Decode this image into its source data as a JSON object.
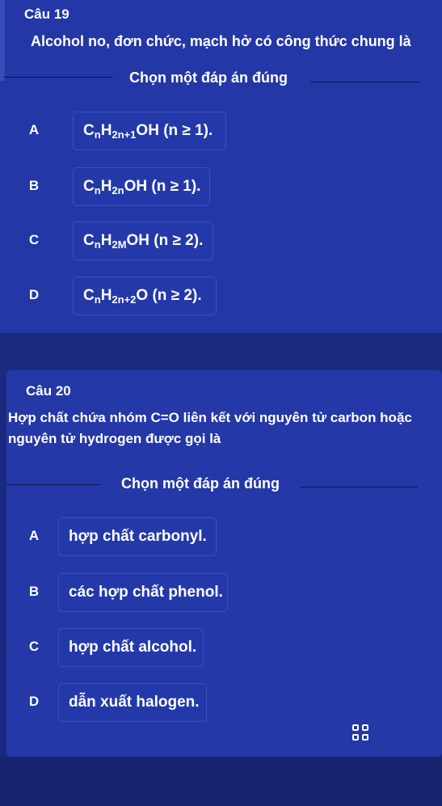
{
  "q19": {
    "number": "Câu 19",
    "question": "Alcohol no, đơn chức, mạch hở có công thức chung là",
    "choose_label": "Chọn một đáp án đúng",
    "options": [
      {
        "letter": "A",
        "parts": [
          "C",
          "n",
          "H",
          "2n+1",
          "OH (n ≥ 1)."
        ]
      },
      {
        "letter": "B",
        "parts": [
          "C",
          "n",
          "H",
          "2n",
          "OH (n ≥ 1)."
        ]
      },
      {
        "letter": "C",
        "parts": [
          "C",
          "n",
          "H",
          "2M",
          "OH (n ≥ 2)."
        ]
      },
      {
        "letter": "D",
        "parts": [
          "C",
          "n",
          "H",
          "2n+2",
          "O (n ≥ 2)."
        ]
      }
    ]
  },
  "q20": {
    "number": "Câu 20",
    "question": "Hợp chất chứa nhóm C=O liên kết với nguyên tử carbon hoặc nguyên tử hydrogen được gọi là",
    "choose_label": "Chọn một đáp án đúng",
    "options": [
      {
        "letter": "A",
        "text": "hợp chất carbonyl."
      },
      {
        "letter": "B",
        "text": "các hợp chất phenol."
      },
      {
        "letter": "C",
        "text": "hợp chất alcohol."
      },
      {
        "letter": "D",
        "text": "dẫn xuất halogen."
      }
    ]
  },
  "icons": {
    "grid": "grid-icon"
  }
}
